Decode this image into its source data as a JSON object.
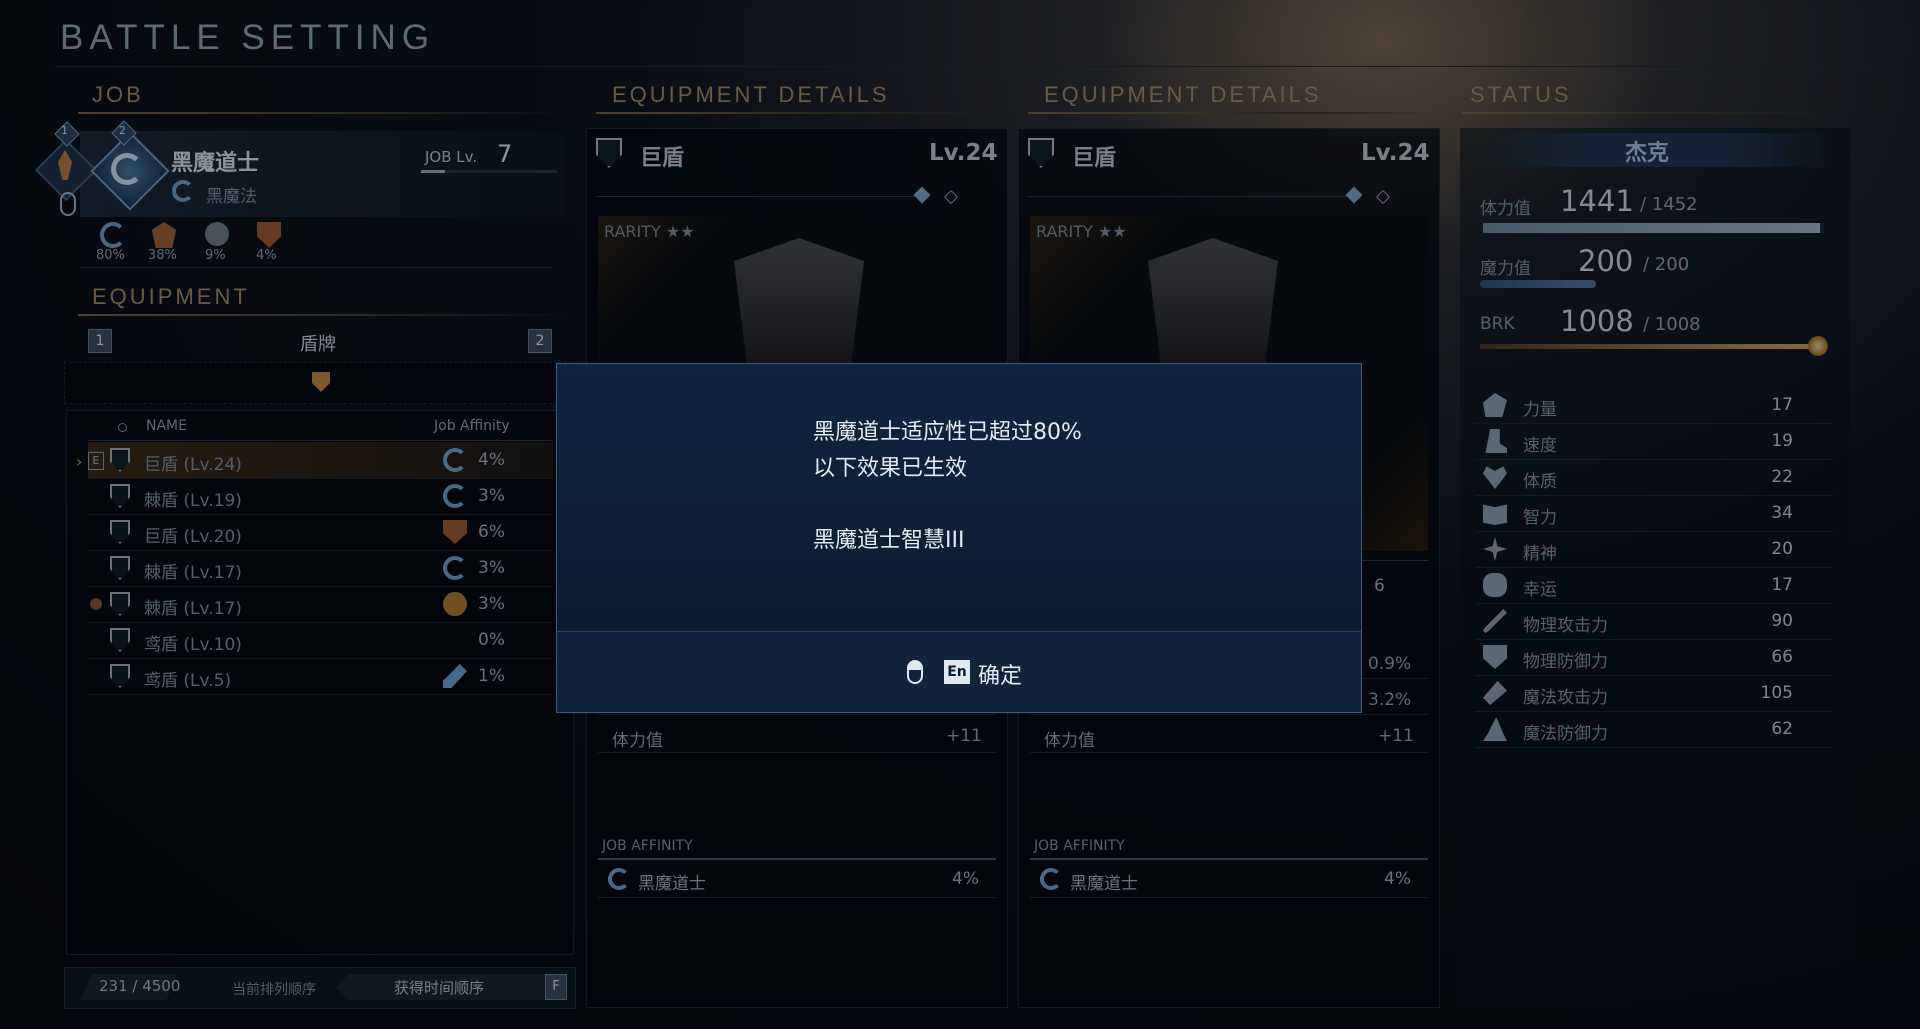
{
  "header": {
    "title": "BATTLE SETTING"
  },
  "job_panel": {
    "heading": "JOB",
    "job_name": "黑魔道士",
    "job_sub": "黑魔法",
    "job_lv_label": "JOB Lv.",
    "job_lv": "7",
    "slot_badges": [
      "1",
      "2"
    ],
    "affinities": [
      "80%",
      "38%",
      "9%",
      "4%"
    ]
  },
  "equipment_panel": {
    "heading": "EQUIPMENT",
    "slot_left": "1",
    "slot_right": "2",
    "category": "盾牌",
    "col_name": "NAME",
    "col_affinity": "Job Affinity",
    "equipped_tag": "E",
    "items": [
      {
        "name": "巨盾 (Lv.24)",
        "pct": "4%",
        "icon": "swirl-icon",
        "selected": true
      },
      {
        "name": "棘盾 (Lv.19)",
        "pct": "3%",
        "icon": "swirl-icon"
      },
      {
        "name": "巨盾 (Lv.20)",
        "pct": "6%",
        "icon": "shield-emblem-icon"
      },
      {
        "name": "棘盾 (Lv.17)",
        "pct": "3%",
        "icon": "swirl-icon"
      },
      {
        "name": "棘盾 (Lv.17)",
        "pct": "3%",
        "icon": "fist-icon"
      },
      {
        "name": "鸢盾 (Lv.10)",
        "pct": "0%",
        "icon": ""
      },
      {
        "name": "鸢盾 (Lv.5)",
        "pct": "1%",
        "icon": "staff-icon"
      }
    ],
    "count": "231 / 4500",
    "sort_label": "当前排列顺序",
    "sort_value": "获得时间顺序",
    "sort_key": "F"
  },
  "details_left": {
    "heading": "EQUIPMENT DETAILS",
    "name": "巨盾",
    "level": "Lv.24",
    "rarity": "RARITY ★★",
    "stat_rows": [
      {
        "label": "",
        "value": ""
      },
      {
        "label": "",
        "value": ""
      },
      {
        "label": "体力值",
        "value": "+11"
      }
    ],
    "job_affinity_label": "JOB AFFINITY",
    "affinity_job": "黑魔道士",
    "affinity_pct": "4%"
  },
  "details_right": {
    "heading": "EQUIPMENT DETAILS",
    "name": "巨盾",
    "level": "Lv.24",
    "rarity": "RARITY ★★",
    "side_value": "6",
    "stat_rows": [
      {
        "label": "",
        "value": "0.9%"
      },
      {
        "label": "",
        "value": "3.2%"
      },
      {
        "label": "体力值",
        "value": "+11"
      }
    ],
    "job_affinity_label": "JOB AFFINITY",
    "affinity_job": "黑魔道士",
    "affinity_pct": "4%"
  },
  "status": {
    "heading": "STATUS",
    "character": "杰克",
    "hp_label": "体力值",
    "hp": "1441",
    "hp_max": "/ 1452",
    "hp_fraction": 0.992,
    "mp_label": "魔力值",
    "mp": "200",
    "mp_max": "/ 200",
    "mp_fraction": 1.0,
    "brk_label": "BRK",
    "brk": "1008",
    "brk_max": "/ 1008",
    "brk_fraction": 1.0,
    "stats": [
      {
        "label": "力量",
        "value": "17",
        "icon": "arm-icon"
      },
      {
        "label": "速度",
        "value": "19",
        "icon": "boot-icon"
      },
      {
        "label": "体质",
        "value": "22",
        "icon": "heart-icon"
      },
      {
        "label": "智力",
        "value": "34",
        "icon": "book-icon"
      },
      {
        "label": "精神",
        "value": "20",
        "icon": "sun-icon"
      },
      {
        "label": "幸运",
        "value": "17",
        "icon": "clover-icon"
      },
      {
        "label": "物理攻击力",
        "value": "90",
        "icon": "sword-icon"
      },
      {
        "label": "物理防御力",
        "value": "66",
        "icon": "shield-icon"
      },
      {
        "label": "魔法攻击力",
        "value": "105",
        "icon": "wand-icon"
      },
      {
        "label": "魔法防御力",
        "value": "62",
        "icon": "hat-icon"
      }
    ]
  },
  "modal": {
    "line1": "黑魔道士适应性已超过80%",
    "line2": "以下效果已生效",
    "line3": "黑魔道士智慧III",
    "key": "En",
    "confirm": "确定"
  },
  "colors": {
    "accent": "#a38a6a",
    "panel": "#050b14",
    "modal": "#0f2540",
    "highlight": "#3a2a1a"
  }
}
